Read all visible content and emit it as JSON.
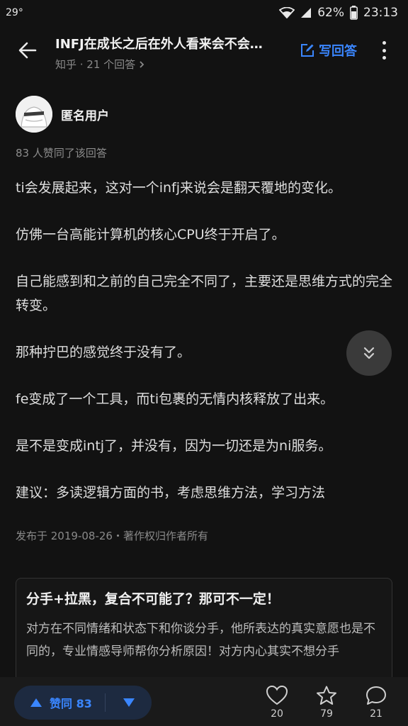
{
  "status_bar": {
    "temperature": "29°",
    "battery": "62%",
    "time": "23:13"
  },
  "header": {
    "title": "INFJ在成长之后在外人看来会不会…",
    "subtitle": "知乎 · 21 个回答",
    "write_answer": "写回答"
  },
  "author": {
    "name": "匿名用户"
  },
  "likes_note": "83 人赞同了该回答",
  "answer": {
    "paragraphs": [
      "ti会发展起来，这对一个infj来说会是翻天覆地的变化。",
      "仿佛一台高能计算机的核心CPU终于开启了。",
      "自己能感到和之前的自己完全不同了，主要还是思维方式的完全转变。",
      "那种拧巴的感觉终于没有了。",
      "fe变成了一个工具，而ti包裹的无情内核释放了出来。",
      "是不是变成intj了，并没有，因为一切还是为ni服务。",
      "建议：多读逻辑方面的书，考虑思维方法，学习方法"
    ],
    "meta": "发布于 2019-08-26・著作权归作者所有"
  },
  "ad": {
    "title": "分手+拉黑，复合不可能了？那可不一定！",
    "body": "对方在不同情绪和状态下和你谈分手，他所表达的真实意愿也是不同的，专业情感导师帮你分析原因！对方内心其实不想分手"
  },
  "bottom_bar": {
    "upvote_label": "赞同 83",
    "like_count": "20",
    "favorite_count": "79",
    "comment_count": "21"
  },
  "colors": {
    "accent": "#3a86ff",
    "background": "#121212"
  }
}
